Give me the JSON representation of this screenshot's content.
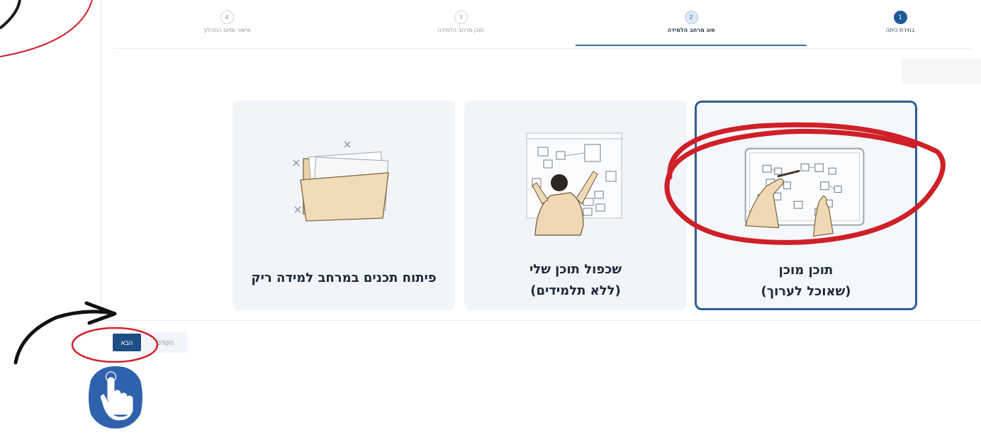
{
  "stepper": {
    "steps": [
      {
        "num": "1",
        "label": "בחירת כיתה",
        "state": "done"
      },
      {
        "num": "2",
        "label": "סוג מרחב הלמידה",
        "state": "active"
      },
      {
        "num": "3",
        "label": "תוכן מרחב הלמידה",
        "state": "todo"
      },
      {
        "num": "4",
        "label": "אישור וסיום התהליך",
        "state": "todo"
      }
    ]
  },
  "cards": [
    {
      "title_line1": "תוכן מוכן",
      "title_line2": "(שאוכל לערוך)",
      "selected": true
    },
    {
      "title_line1": "שכפול תוכן שלי",
      "title_line2": "(ללא תלמידים)",
      "selected": false
    },
    {
      "title_line1": "פיתוח תכנים במרחב למידה ריק",
      "title_line2": "",
      "selected": false
    }
  ],
  "buttons": {
    "next": "הבא",
    "prev": "הקודם"
  },
  "colors": {
    "primary": "#1d4e84",
    "card_bg": "#f1f5fa",
    "selected_border": "#2f5e90",
    "annotation_red": "#d0222b"
  },
  "icons": {
    "hand": "hand-pointer-icon",
    "folder": "folder-icon"
  }
}
